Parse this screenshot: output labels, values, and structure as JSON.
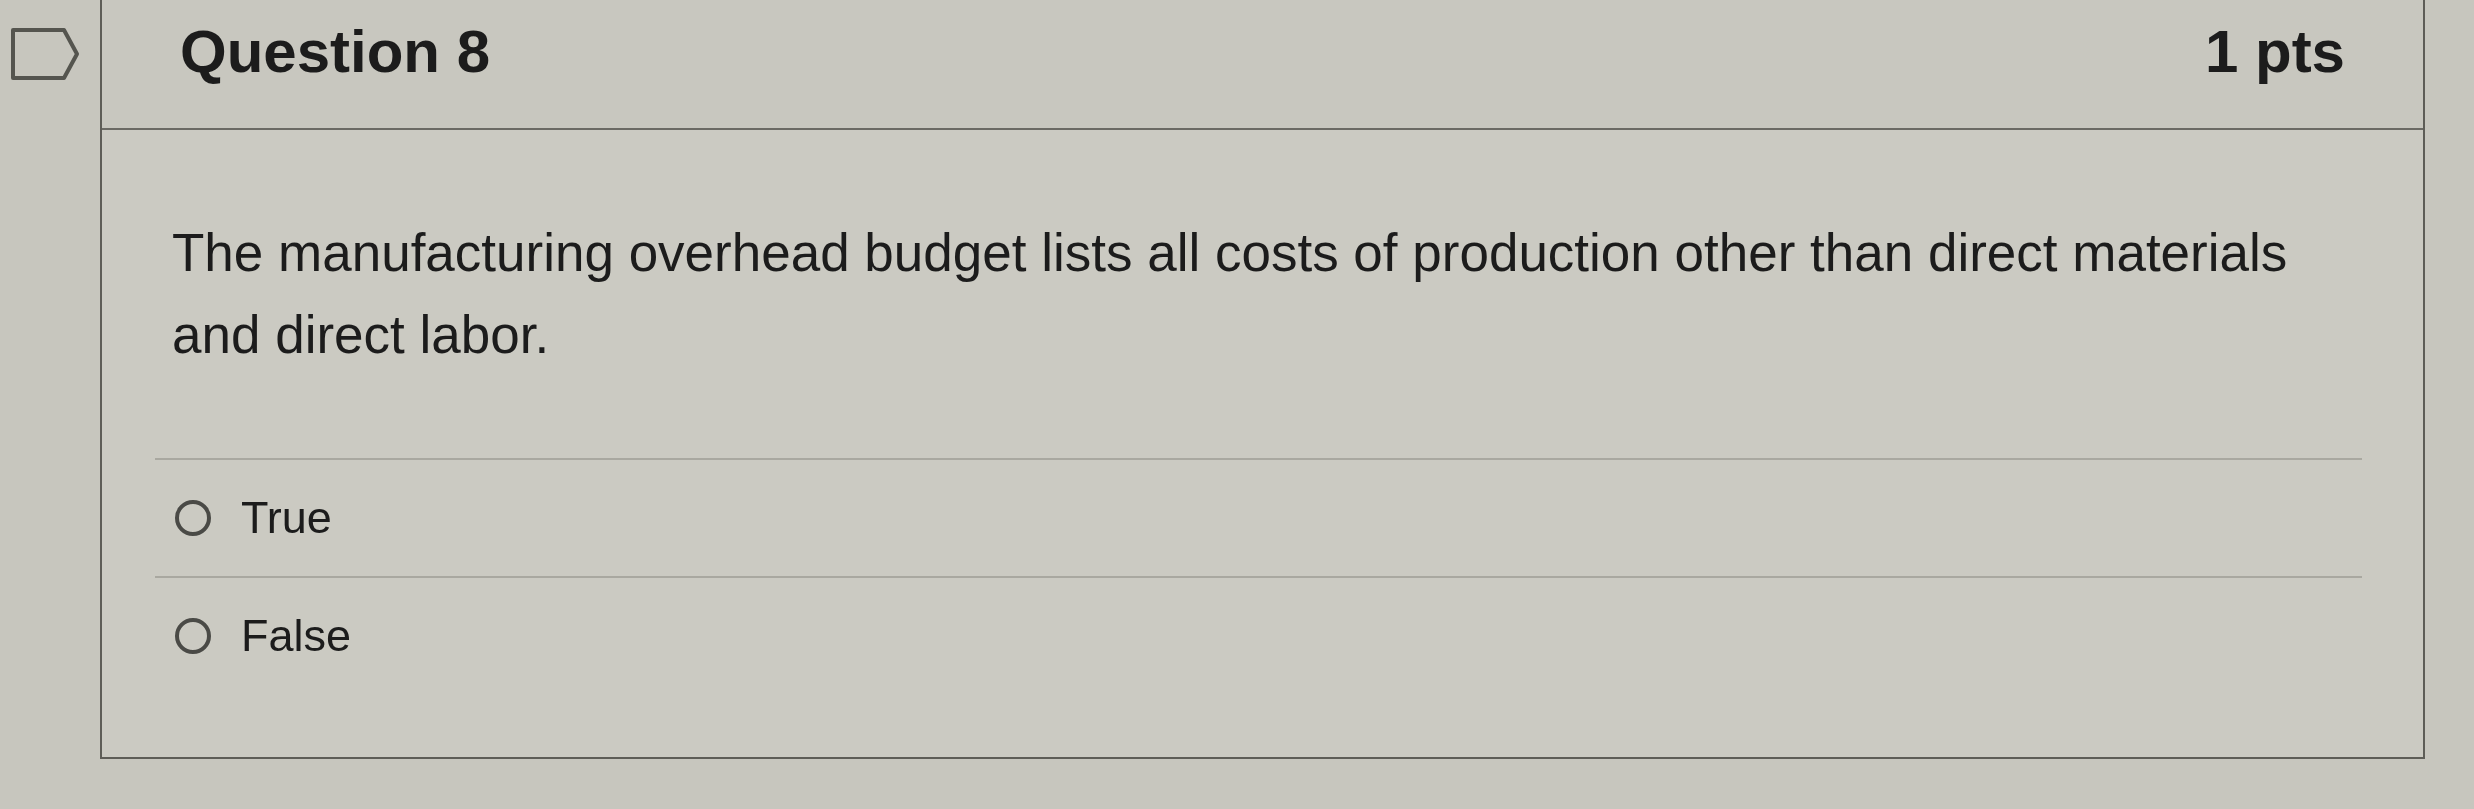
{
  "question": {
    "flagged": false,
    "title": "Question 8",
    "points": "1 pts"
  },
  "prompt": "The manufacturing overhead budget lists all costs of production other than direct materials and direct labor.",
  "answers": [
    {
      "label": "True",
      "selected": false
    },
    {
      "label": "False",
      "selected": false
    }
  ]
}
